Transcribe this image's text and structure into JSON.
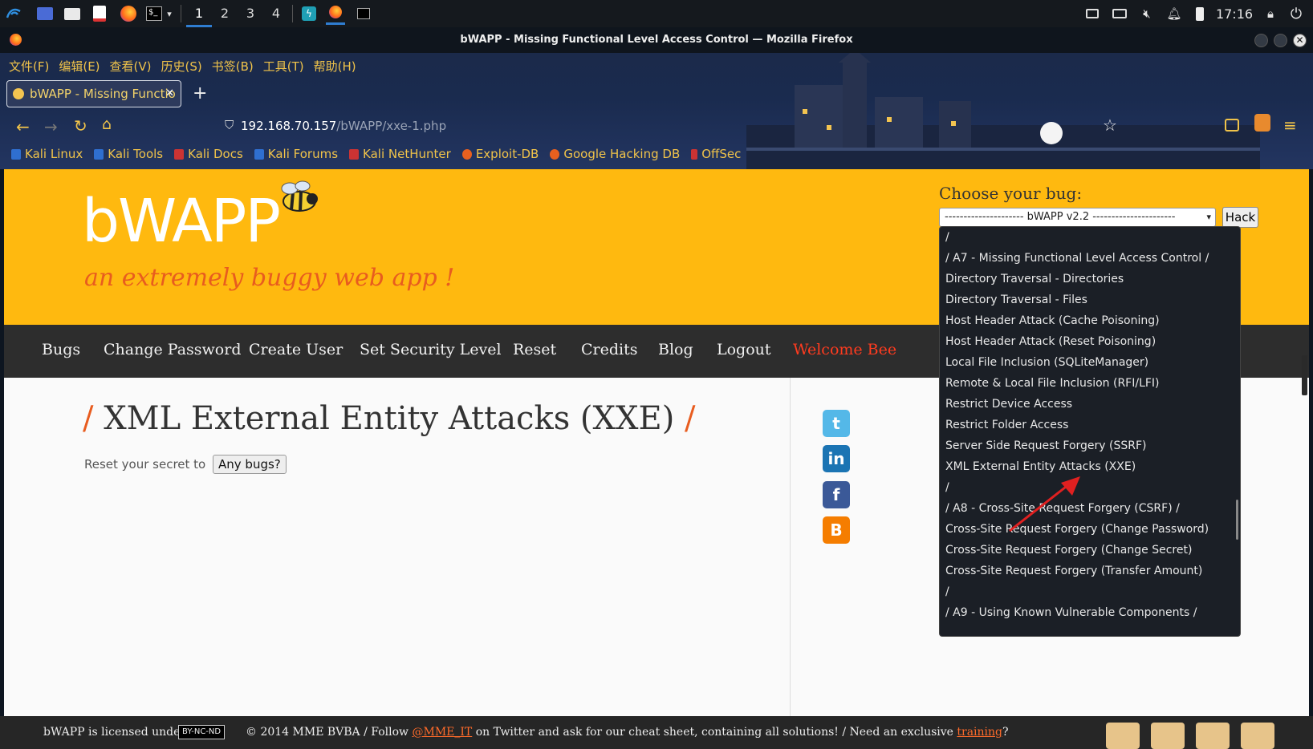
{
  "taskbar": {
    "workspaces": [
      "1",
      "2",
      "3",
      "4"
    ],
    "clock": "17:16"
  },
  "window": {
    "title": "bWAPP - Missing Functional Level Access Control — Mozilla Firefox"
  },
  "browser": {
    "menu": [
      "文件(F)",
      "编辑(E)",
      "查看(V)",
      "历史(S)",
      "书签(B)",
      "工具(T)",
      "帮助(H)"
    ],
    "tab_title": "bWAPP - Missing Functio",
    "url_host": "192.168.70.157",
    "url_path": "/bWAPP/xxe-1.php",
    "bookmarks": [
      "Kali Linux",
      "Kali Tools",
      "Kali Docs",
      "Kali Forums",
      "Kali NetHunter",
      "Exploit-DB",
      "Google Hacking DB",
      "OffSec"
    ],
    "new_tab_symbol": "+"
  },
  "header": {
    "logo": "bWAPP",
    "tagline": "an extremely buggy web app !",
    "choose_label": "Choose your bug:",
    "select_value": "--------------------- bWAPP v2.2 ----------------------",
    "hack_button": "Hack"
  },
  "nav": {
    "items": [
      "Bugs",
      "Change Password",
      "Create User",
      "Set Security Level",
      "Reset",
      "Credits",
      "Blog",
      "Logout"
    ],
    "welcome": "Welcome Bee"
  },
  "main": {
    "heading_slash": "/",
    "heading": "XML External Entity Attacks (XXE)",
    "reset_text": "Reset your secret to",
    "any_bugs": "Any bugs?"
  },
  "dropdown": {
    "options": [
      "/",
      "/ A7 - Missing Functional Level Access Control /",
      "Directory Traversal - Directories",
      "Directory Traversal - Files",
      "Host Header Attack (Cache Poisoning)",
      "Host Header Attack (Reset Poisoning)",
      "Local File Inclusion (SQLiteManager)",
      "Remote & Local File Inclusion (RFI/LFI)",
      "Restrict Device Access",
      "Restrict Folder Access",
      "Server Side Request Forgery (SSRF)",
      "XML External Entity Attacks (XXE)",
      "/",
      "/ A8 - Cross-Site Request Forgery (CSRF) /",
      "Cross-Site Request Forgery (Change Password)",
      "Cross-Site Request Forgery (Change Secret)",
      "Cross-Site Request Forgery (Transfer Amount)",
      "/",
      "/ A9 - Using Known Vulnerable Components /"
    ]
  },
  "footer": {
    "t1": "bWAPP is licensed under",
    "license": "BY-NC-ND",
    "t2": "© 2014 MME BVBA / Follow",
    "twitter": "@MME_IT",
    "t3": "on Twitter and ask for our cheat sheet, containing all solutions! / Need an exclusive",
    "training": "training",
    "t4": "?"
  },
  "colors": {
    "header_bg": "#ffb90f",
    "accent": "#e85c1f",
    "nav_bg": "#2d2d2d",
    "dropdown_bg": "#1b1f26",
    "annotation_arrow": "#e02020"
  }
}
